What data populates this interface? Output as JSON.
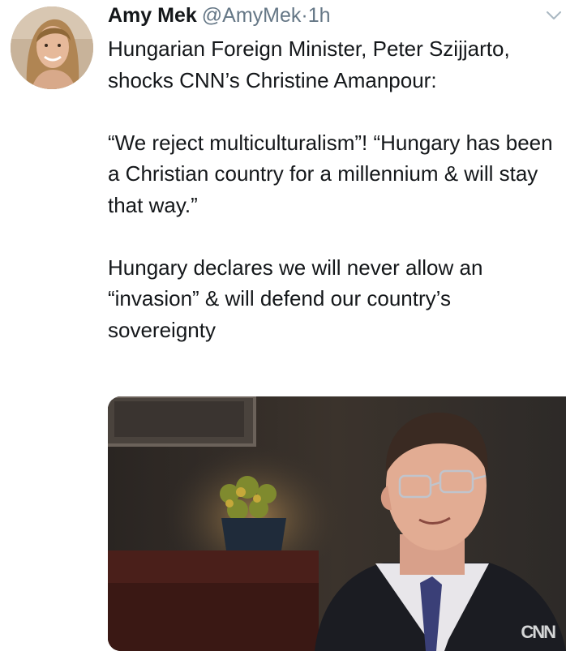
{
  "tweet": {
    "author_name": "Amy Mek",
    "author_handle": "@AmyMek",
    "separator": "·",
    "timestamp": "1h",
    "paragraphs": [
      "Hungarian Foreign Minister, Peter Szijjarto, shocks CNN’s Christine Amanpour:",
      "“We reject multiculturalism”! “Hungary has been a Christian country for a millennium & will stay that way.”",
      "Hungary declares we will never allow an “invasion” & will defend our country’s sovereignty"
    ],
    "media": {
      "watermark": "CNN"
    }
  },
  "icons": {
    "avatar": "avatar",
    "menu": "chevron-down-icon"
  },
  "colors": {
    "text": "#14171a",
    "secondary": "#657786"
  }
}
